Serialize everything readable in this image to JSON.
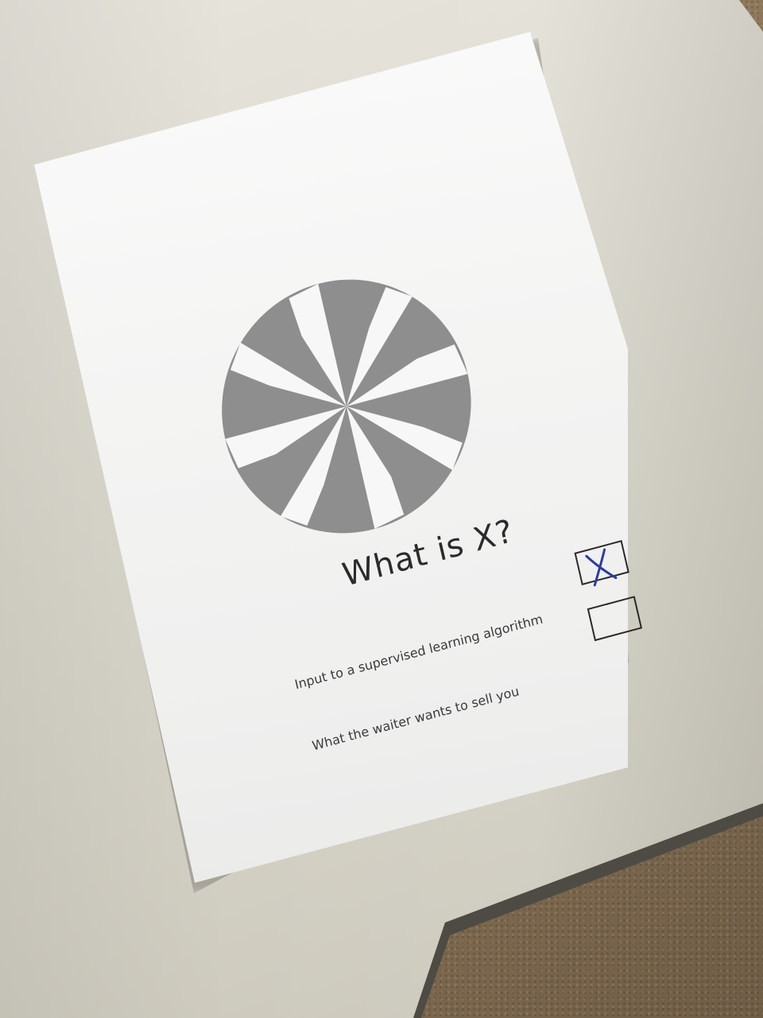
{
  "question": {
    "title": "What is X?"
  },
  "options": [
    {
      "label": "Input to a supervised learning algorithm",
      "checked": true,
      "mark": "X"
    },
    {
      "label": "What the waiter wants to sell you",
      "checked": false,
      "mark": ""
    }
  ],
  "logo": {
    "icon": "pinwheel-logo-icon",
    "fill_color": "#8e8e8e",
    "background_color": "#f7f7f7"
  },
  "colors": {
    "paper": "#f4f4f3",
    "ink": "#2b2b2b",
    "pen": "#2c3d9c",
    "table": "#dddbd0"
  }
}
